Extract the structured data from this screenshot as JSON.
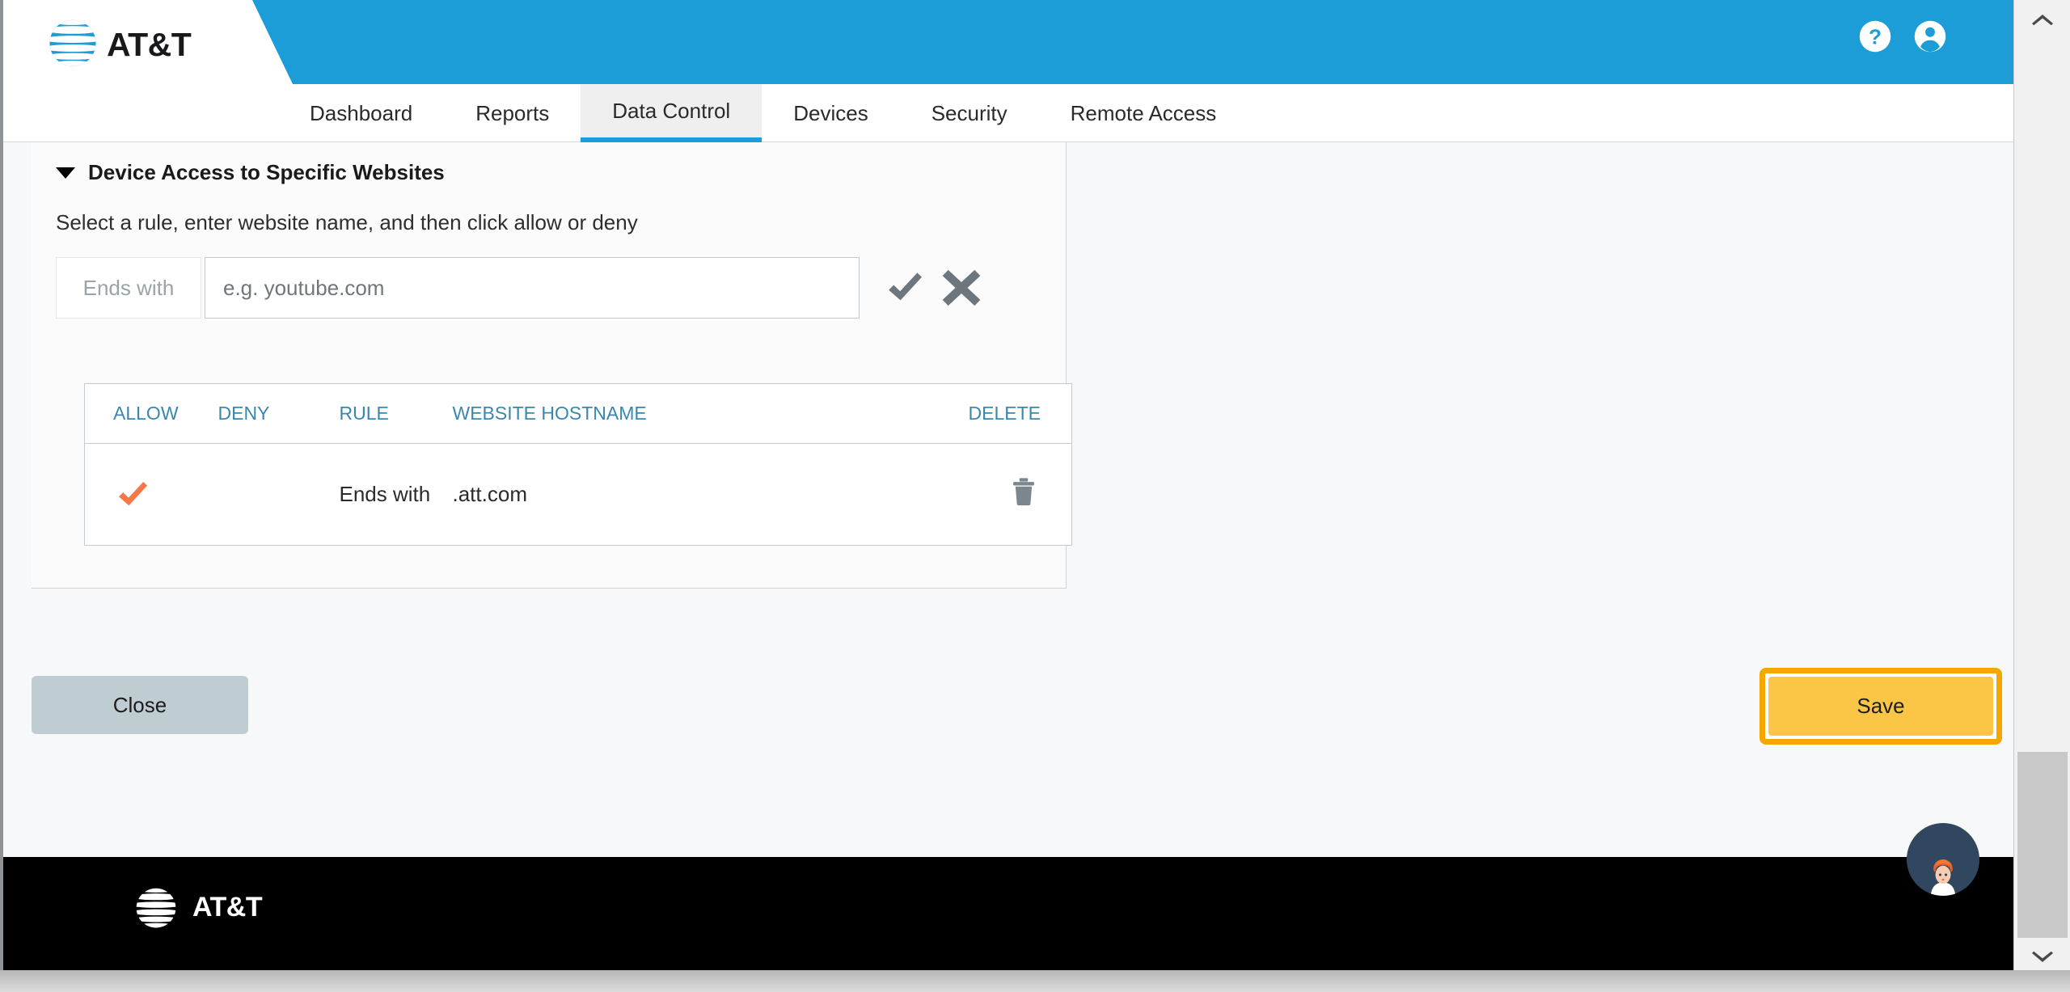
{
  "brand": {
    "name": "AT&T",
    "accent_blue": "#1c9dd7",
    "accent_orange": "#f4784a",
    "save_yellow": "#fbc645",
    "focus_orange": "#f5a700",
    "link_blue": "#3a87ad"
  },
  "header": {
    "logo_text": "AT&T",
    "icons": [
      {
        "name": "help-icon",
        "label": "Help"
      },
      {
        "name": "account-icon",
        "label": "Account"
      }
    ]
  },
  "nav": {
    "items": [
      {
        "label": "Dashboard",
        "active": false
      },
      {
        "label": "Reports",
        "active": false
      },
      {
        "label": "Data Control",
        "active": true
      },
      {
        "label": "Devices",
        "active": false
      },
      {
        "label": "Security",
        "active": false
      },
      {
        "label": "Remote Access",
        "active": false
      }
    ]
  },
  "panel": {
    "section_title": "Device Access to Specific Websites",
    "description": "Select a rule, enter website name, and then click allow or deny",
    "rule_entry": {
      "rule_selected": "Ends with",
      "hostname_value": "",
      "hostname_placeholder": "e.g. youtube.com",
      "allow_action_label": "Allow",
      "deny_action_label": "Deny"
    },
    "table": {
      "columns": [
        "ALLOW",
        "DENY",
        "RULE",
        "WEBSITE HOSTNAME",
        "DELETE"
      ],
      "rows": [
        {
          "allow": "checked",
          "deny": "",
          "rule": "Ends with",
          "hostname": ".att.com",
          "delete": "trash-icon"
        }
      ]
    }
  },
  "actions": {
    "close_label": "Close",
    "save_label": "Save"
  },
  "chat": {
    "avatar_label": "Virtual assistant"
  },
  "footer": {
    "logo_text": "AT&T"
  }
}
